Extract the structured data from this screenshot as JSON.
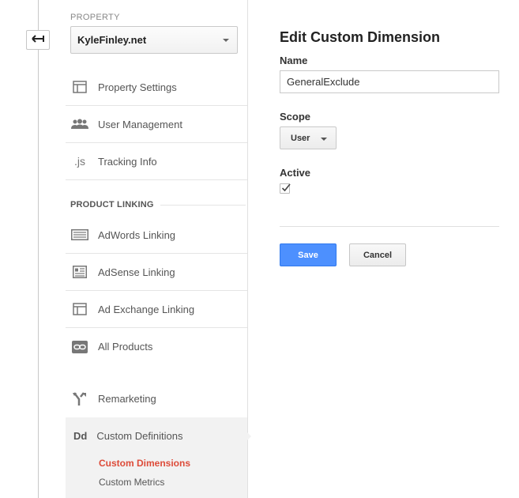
{
  "sidebar": {
    "property_label": "PROPERTY",
    "property_value": "KyleFinley.net",
    "items": [
      {
        "label": "Property Settings",
        "icon": "window-icon"
      },
      {
        "label": "User Management",
        "icon": "users-icon"
      },
      {
        "label": "Tracking Info",
        "icon": "js-icon"
      }
    ],
    "section_header": "PRODUCT LINKING",
    "linking_items": [
      {
        "label": "AdWords Linking",
        "icon": "adwords-icon"
      },
      {
        "label": "AdSense Linking",
        "icon": "adsense-icon"
      },
      {
        "label": "Ad Exchange Linking",
        "icon": "window-icon"
      },
      {
        "label": "All Products",
        "icon": "link-icon"
      }
    ],
    "remarketing": {
      "label": "Remarketing",
      "icon": "fork-icon"
    },
    "custom_definitions": {
      "label": "Custom Definitions",
      "icon_text": "Dd",
      "sub_items": [
        {
          "label": "Custom Dimensions",
          "active": true
        },
        {
          "label": "Custom Metrics",
          "active": false
        }
      ]
    }
  },
  "main": {
    "title": "Edit Custom Dimension",
    "name_label": "Name",
    "name_value": "GeneralExclude",
    "scope_label": "Scope",
    "scope_value": "User",
    "active_label": "Active",
    "active_checked": true,
    "save_label": "Save",
    "cancel_label": "Cancel"
  },
  "colors": {
    "accent_blue": "#4d90fe",
    "active_link_red": "#dd4b39",
    "active_bg": "#f2f2f2"
  }
}
